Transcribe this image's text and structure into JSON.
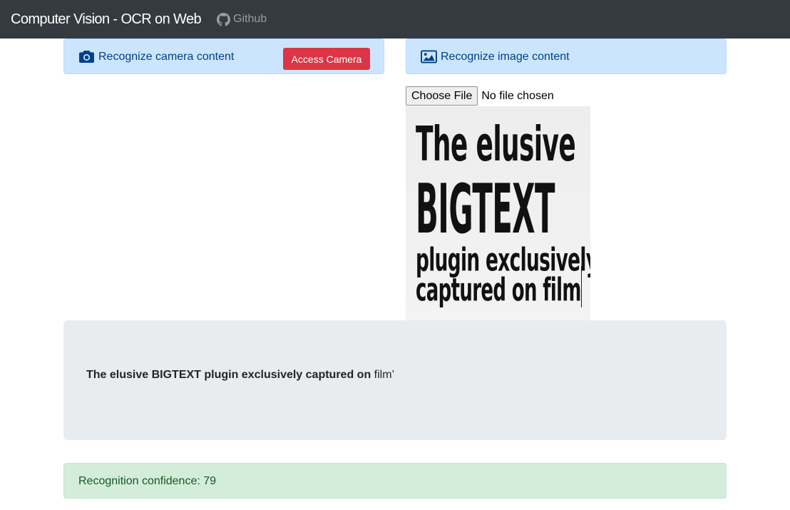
{
  "navbar": {
    "brand": "Computer Vision - OCR on Web",
    "github_label": "Github"
  },
  "camera_card": {
    "icon": "camera-icon",
    "label": "Recognize camera content",
    "button_label": "Access Camera"
  },
  "image_card": {
    "icon": "image-icon",
    "label": "Recognize image content"
  },
  "file_input": {
    "button_label": "Choose File",
    "status": "No file chosen"
  },
  "preview_image": {
    "lines": [
      "The elusive",
      "BIGTEXT",
      "plugin exclusively",
      "captured on film"
    ]
  },
  "result": {
    "strong_text": "The elusive BIGTEXT plugin exclusively captured on",
    "normal_text": " film’"
  },
  "confidence": {
    "text": "Recognition confidence: 79"
  },
  "colors": {
    "navbar": "#343a40",
    "info_bg": "#cce5ff",
    "danger": "#dc3545",
    "success_bg": "#d4edda",
    "jumbotron_bg": "#e9ecef"
  }
}
